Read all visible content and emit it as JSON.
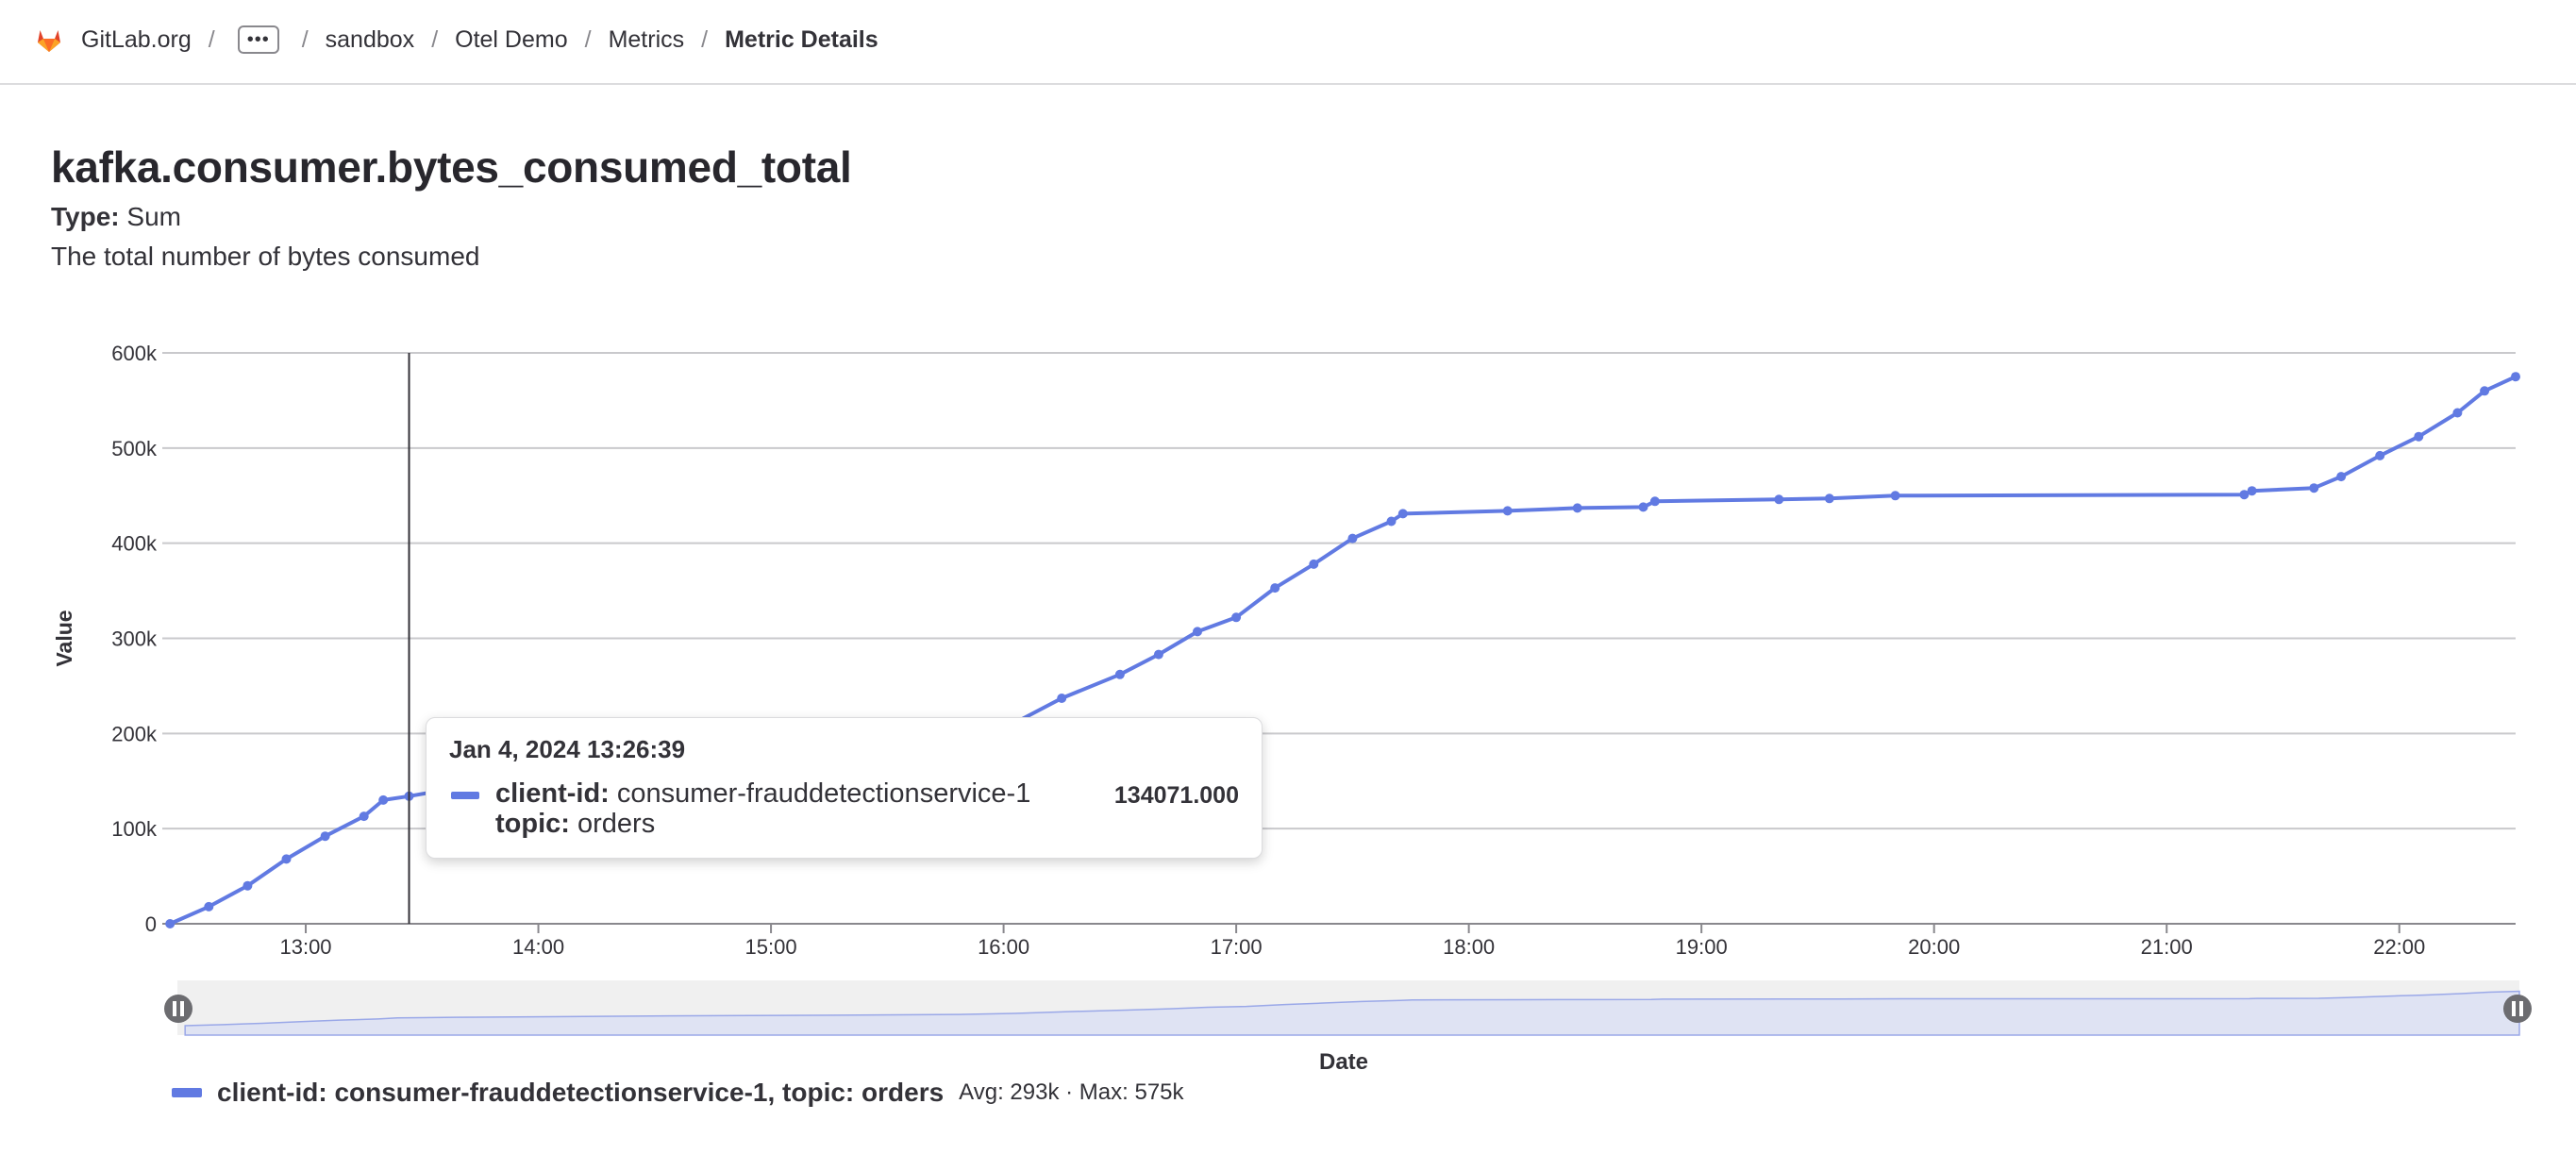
{
  "breadcrumb": {
    "org": "GitLab.org",
    "more": "•••",
    "items": [
      "sandbox",
      "Otel Demo",
      "Metrics"
    ],
    "current": "Metric Details",
    "separator": "/"
  },
  "metric": {
    "name": "kafka.consumer.bytes_consumed_total",
    "type_label": "Type:",
    "type_value": "Sum",
    "description": "The total number of bytes consumed"
  },
  "tooltip": {
    "time": "Jan 4, 2024 13:26:39",
    "client_label": "client-id:",
    "client_value": "consumer-frauddetectionservice-1",
    "topic_label": "topic:",
    "topic_value": "orders",
    "value": "134071.000"
  },
  "legend": {
    "name": "client-id: consumer-frauddetectionservice-1, topic: orders",
    "stats": "Avg: 293k · Max: 575k"
  },
  "colors": {
    "series": "#617ae2",
    "grid": "#c9c9cc",
    "text": "#333238"
  },
  "chart_data": {
    "type": "line",
    "xlabel": "Date",
    "ylabel": "Value",
    "x_ticks": [
      "13:00",
      "14:00",
      "15:00",
      "16:00",
      "17:00",
      "18:00",
      "19:00",
      "20:00",
      "21:00",
      "22:00"
    ],
    "y_ticks": [
      "0",
      "100k",
      "200k",
      "300k",
      "400k",
      "500k",
      "600k"
    ],
    "ylim": [
      0,
      600000
    ],
    "xlim": [
      "12:23",
      "22:30"
    ],
    "grid": true,
    "legend_position": "bottom",
    "hover_time": "13:26:39",
    "series": [
      {
        "name": "client-id: consumer-frauddetectionservice-1, topic: orders",
        "color": "#617ae2",
        "points": [
          [
            "12:25",
            0
          ],
          [
            "12:35",
            18000
          ],
          [
            "12:45",
            40000
          ],
          [
            "12:55",
            68000
          ],
          [
            "13:05",
            92000
          ],
          [
            "13:15",
            113000
          ],
          [
            "13:20",
            130000
          ],
          [
            "13:26:39",
            134071
          ],
          [
            "13:35",
            140000
          ],
          [
            "14:00",
            150000
          ],
          [
            "14:30",
            163000
          ],
          [
            "15:00",
            172000
          ],
          [
            "15:30",
            181000
          ],
          [
            "15:45",
            187000
          ],
          [
            "16:00",
            205000
          ],
          [
            "16:15",
            237000
          ],
          [
            "16:30",
            262000
          ],
          [
            "16:40",
            283000
          ],
          [
            "16:50",
            307000
          ],
          [
            "17:00",
            322000
          ],
          [
            "17:10",
            353000
          ],
          [
            "17:20",
            378000
          ],
          [
            "17:30",
            405000
          ],
          [
            "17:40",
            423000
          ],
          [
            "17:43",
            431000
          ],
          [
            "18:10",
            434000
          ],
          [
            "18:28",
            437000
          ],
          [
            "18:45",
            438000
          ],
          [
            "18:48",
            444000
          ],
          [
            "19:20",
            446000
          ],
          [
            "19:33",
            447000
          ],
          [
            "19:50",
            450000
          ],
          [
            "21:20",
            451000
          ],
          [
            "21:22",
            455000
          ],
          [
            "21:38",
            458000
          ],
          [
            "21:45",
            470000
          ],
          [
            "21:55",
            492000
          ],
          [
            "22:05",
            512000
          ],
          [
            "22:15",
            537000
          ],
          [
            "22:22",
            560000
          ],
          [
            "22:30",
            575000
          ]
        ]
      }
    ]
  }
}
